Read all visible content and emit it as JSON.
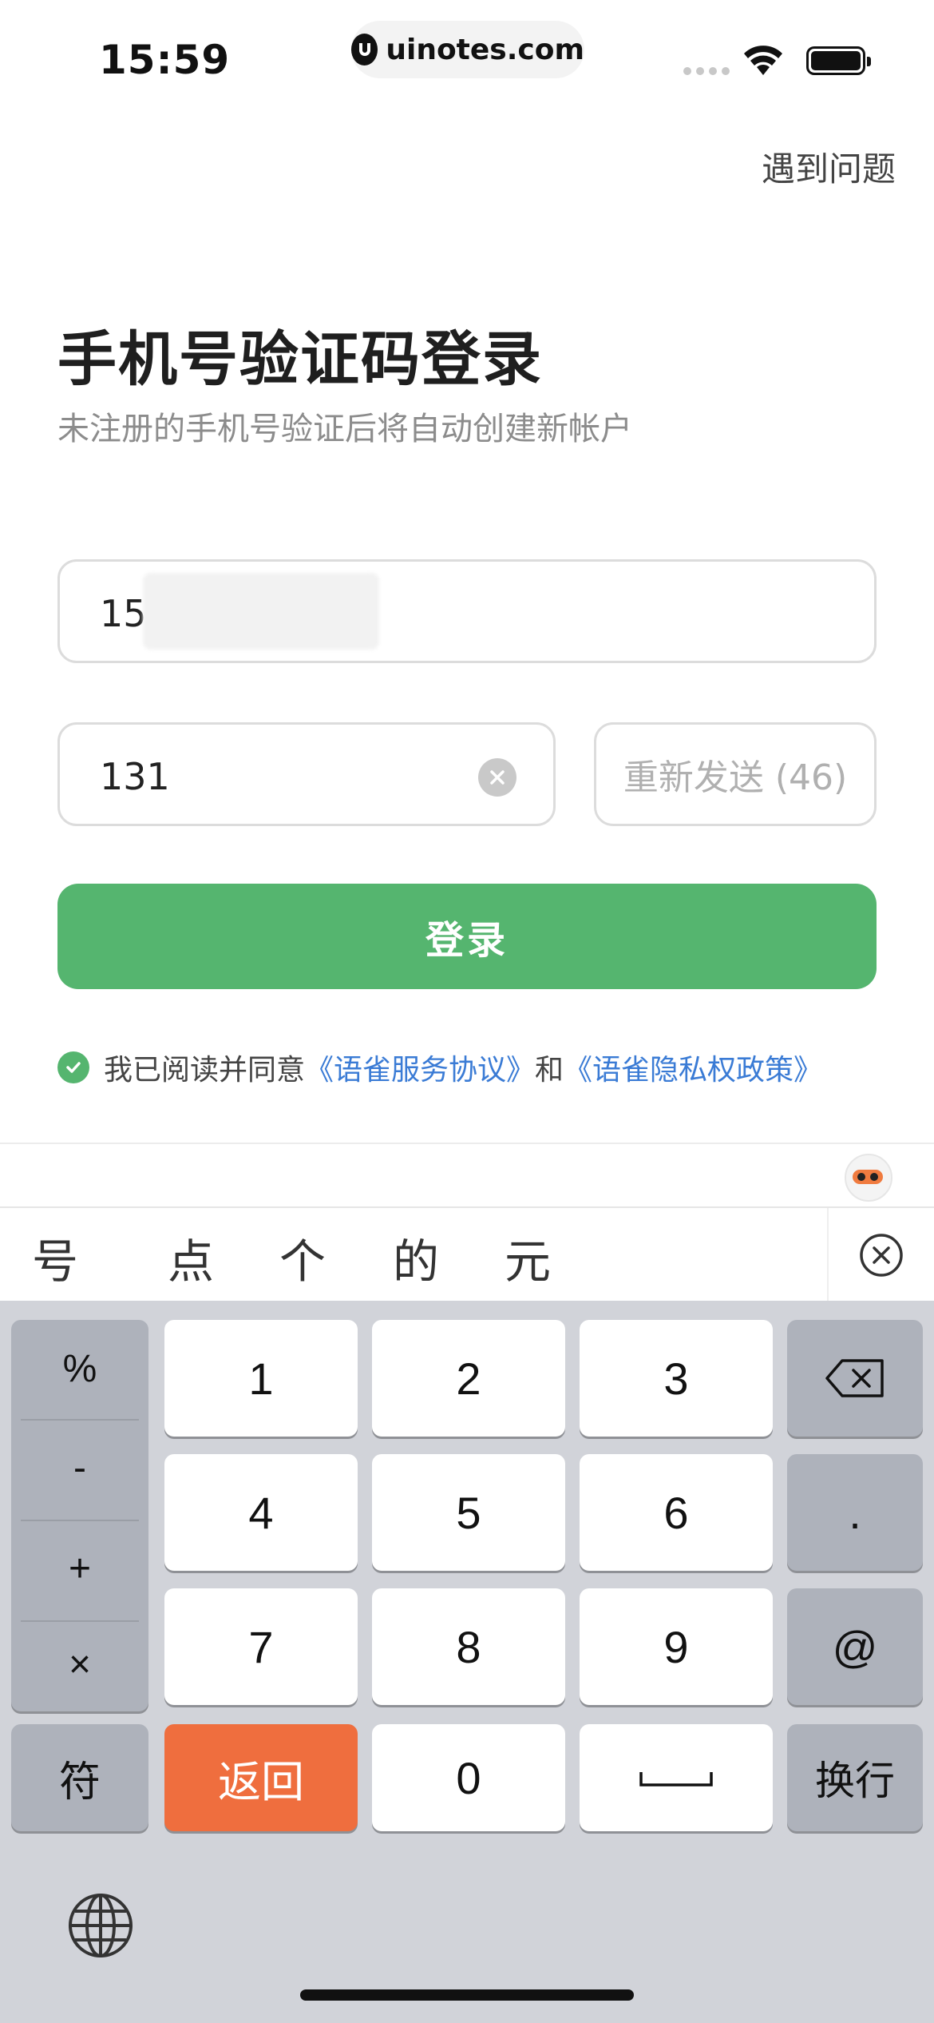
{
  "status_bar": {
    "time": "15:59",
    "url": "uinotes.com"
  },
  "header": {
    "help": "遇到问题"
  },
  "login": {
    "title": "手机号验证码登录",
    "subtitle": "未注册的手机号验证后将自动创建新帐户",
    "phone_value": "15",
    "code_value": "131",
    "resend_label": "重新发送 (46)",
    "login_button": "登录",
    "agreement": {
      "prefix": "我已阅读并同意",
      "terms_link": "《语雀服务协议》",
      "conjunction": "和",
      "privacy_link": "《语雀隐私权政策》"
    }
  },
  "keyboard": {
    "candidates": [
      "号",
      "点",
      "个",
      "的",
      "元"
    ],
    "side_symbols": [
      "%",
      "-",
      "+",
      "×"
    ],
    "digits": [
      "1",
      "2",
      "3",
      "4",
      "5",
      "6",
      "7",
      "8",
      "9",
      "0"
    ],
    "dot": ".",
    "at": "@",
    "symbols_key": "符",
    "back_key": "返回",
    "return_key": "换行"
  },
  "colors": {
    "accent": "#55b56f",
    "link": "#3a7bd5",
    "back_key": "#ef6e3e"
  }
}
